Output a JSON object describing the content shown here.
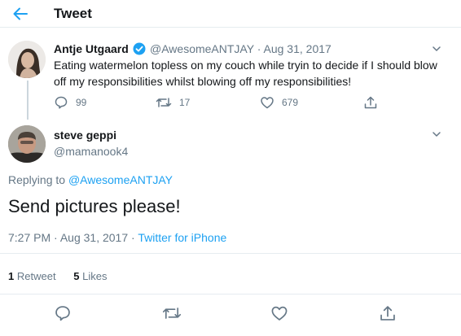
{
  "header": {
    "title": "Tweet"
  },
  "parent_tweet": {
    "name": "Antje Utgaard",
    "handle": "@AwesomeANTJAY",
    "date_sep": "·",
    "date": "Aug 31, 2017",
    "text": "Eating watermelon topless on my couch while tryin to decide if I should blow off my responsibilities whilst blowing off my responsibilities!",
    "replies": "99",
    "retweets": "17",
    "likes": "679"
  },
  "reply_tweet": {
    "name": "steve geppi",
    "handle": "@mamanook4",
    "replying_prefix": "Replying to",
    "replying_to": "@AwesomeANTJAY",
    "text": "Send pictures please!",
    "time": "7:27 PM",
    "date_sep": "·",
    "date": "Aug 31, 2017",
    "source_sep": "·",
    "source": "Twitter for iPhone",
    "retweet_count": "1",
    "retweet_label": "Retweet",
    "like_count": "5",
    "like_label": "Likes"
  },
  "colors": {
    "accent": "#1da1f2",
    "secondary_text": "#657786",
    "divider": "#e6ecf0"
  },
  "icons": [
    "back-arrow-icon",
    "verified-badge-icon",
    "chevron-down-icon",
    "reply-icon",
    "retweet-icon",
    "like-icon",
    "share-icon"
  ]
}
